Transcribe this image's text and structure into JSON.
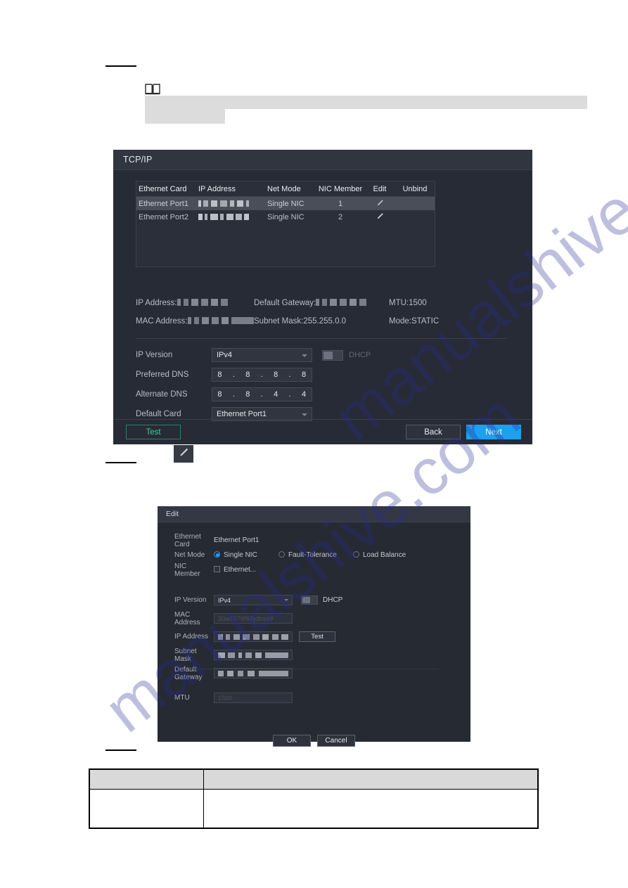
{
  "page": {
    "watermark": "manualshive.com",
    "note_icon": "book-icon"
  },
  "tcpip_dialog": {
    "title": "TCP/IP",
    "table": {
      "columns": [
        "Ethernet Card",
        "IP Address",
        "Net Mode",
        "NIC Member",
        "Edit",
        "Unbind"
      ],
      "rows": [
        {
          "ethernet_card": "Ethernet Port1",
          "ip_address": "",
          "net_mode": "Single NIC",
          "nic_member": "1",
          "edit_icon": "pencil-icon",
          "unbind": "",
          "selected": true
        },
        {
          "ethernet_card": "Ethernet Port2",
          "ip_address": "",
          "net_mode": "Single NIC",
          "nic_member": "2",
          "edit_icon": "pencil-icon",
          "unbind": "",
          "selected": false
        }
      ]
    },
    "info": {
      "ip_address_label": "IP Address:",
      "ip_address_value": "",
      "default_gateway_label": "Default Gateway:",
      "default_gateway_value": "",
      "mtu_label": "MTU:",
      "mtu_value": "1500",
      "mac_address_label": "MAC Address:",
      "mac_address_value": "",
      "subnet_mask_label": "Subnet Mask:",
      "subnet_mask_value": "255.255.0.0",
      "mode_label": "Mode:",
      "mode_value": "STATIC"
    },
    "form": {
      "ip_version_label": "IP Version",
      "ip_version_value": "IPv4",
      "dhcp_label": "DHCP",
      "preferred_dns_label": "Preferred DNS",
      "preferred_dns": [
        "8",
        "8",
        "8",
        "8"
      ],
      "alternate_dns_label": "Alternate DNS",
      "alternate_dns": [
        "8",
        "8",
        "4",
        "4"
      ],
      "default_card_label": "Default Card",
      "default_card_value": "Ethernet Port1"
    },
    "footer": {
      "test_label": "Test",
      "back_label": "Back",
      "next_label": "Next",
      "test_color": "#3ecfa0",
      "next_color": "#1ca0f0"
    }
  },
  "pencil_button": {
    "icon": "pencil-icon"
  },
  "edit_dialog": {
    "title": "Edit",
    "ethernet_card_label": "Ethernet Card",
    "ethernet_card_value": "Ethernet Port1",
    "net_mode_label": "Net Mode",
    "net_mode_options": [
      {
        "label": "Single NIC",
        "selected": true
      },
      {
        "label": "Fault-Tolerance",
        "selected": false
      },
      {
        "label": "Load Balance",
        "selected": false
      }
    ],
    "nic_member_label": "NIC Member",
    "nic_member_option": "Ethernet...",
    "ip_version_label": "IP Version",
    "ip_version_value": "IPv4",
    "dhcp_label": "DHCP",
    "mac_address_label": "MAC Address",
    "mac_address_value": "",
    "ip_address_label": "IP Address",
    "ip_address_value": "",
    "test_label": "Test",
    "subnet_mask_label": "Subnet Mask",
    "subnet_mask_value": "",
    "default_gateway_label": "Default Gateway",
    "default_gateway_value": "",
    "mtu_label": "MTU",
    "mtu_value": "",
    "ok_label": "OK",
    "cancel_label": "Cancel"
  },
  "doc_table": {
    "header": [
      "",
      ""
    ],
    "rows": [
      [
        "",
        ""
      ]
    ]
  }
}
